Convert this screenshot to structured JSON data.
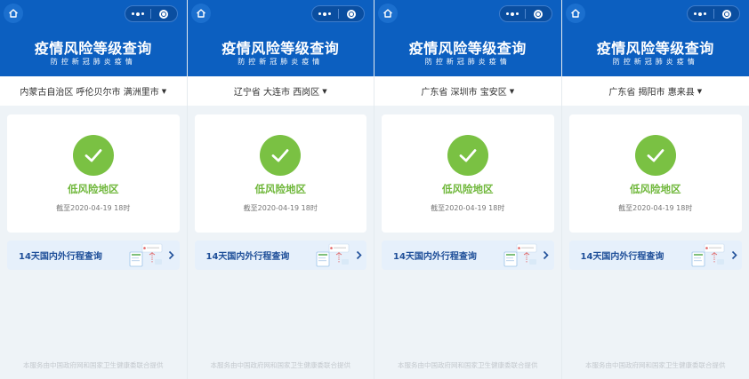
{
  "header": {
    "title": "疫情风险等级查询",
    "subtitle": "防控新冠肺炎疫情"
  },
  "panels": [
    {
      "region": "内蒙古自治区 呼伦贝尔市 满洲里市",
      "risk_level": "低风险地区",
      "as_of": "截至2020-04-19 18时",
      "trip_query": "14天国内外行程查询"
    },
    {
      "region": "辽宁省 大连市 西岗区",
      "risk_level": "低风险地区",
      "as_of": "截至2020-04-19 18时",
      "trip_query": "14天国内外行程查询"
    },
    {
      "region": "广东省 深圳市 宝安区",
      "risk_level": "低风险地区",
      "as_of": "截至2020-04-19 18时",
      "trip_query": "14天国内外行程查询"
    },
    {
      "region": "广东省 揭阳市 惠来县",
      "risk_level": "低风险地区",
      "as_of": "截至2020-04-19 18时",
      "trip_query": "14天国内外行程查询"
    }
  ],
  "footer": "本服务由中国政府网和国家卫生健康委联合提供",
  "colors": {
    "header": "#0c5fc0",
    "success": "#7ac143",
    "accent": "#1f4f99"
  },
  "icons": [
    "home-icon",
    "more-dots-icon",
    "target-close-icon",
    "checkmark-icon",
    "chevron-right-icon",
    "caret-down-icon"
  ]
}
